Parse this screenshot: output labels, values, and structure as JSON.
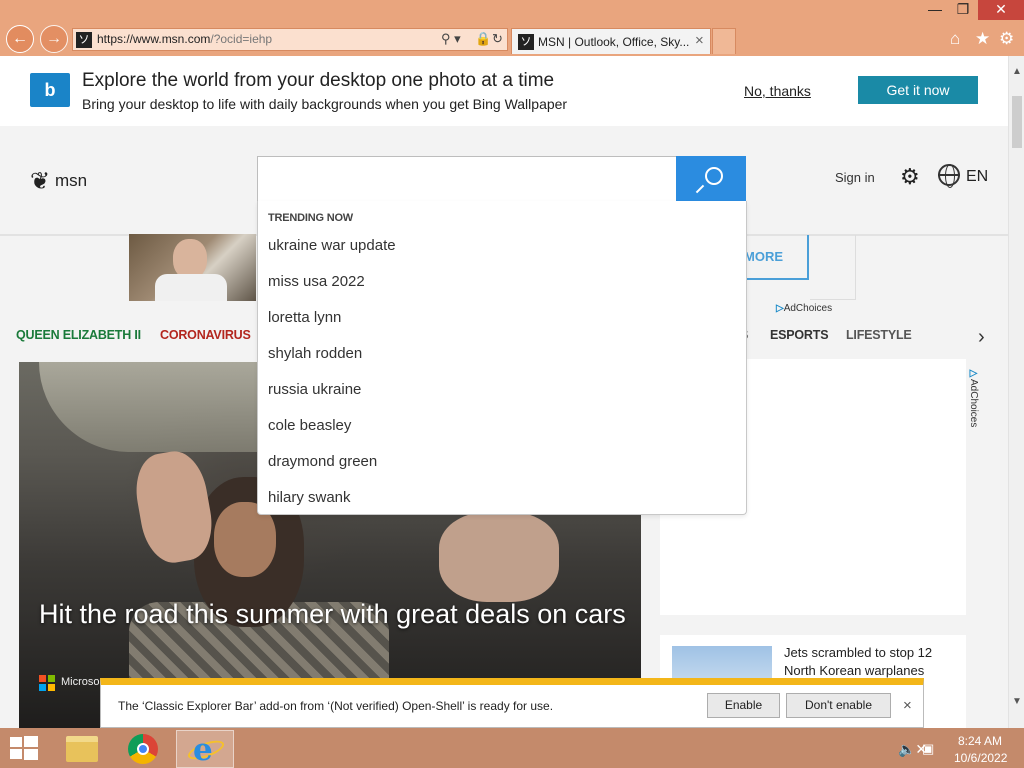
{
  "browser": {
    "address_url_main": "https://www.msn.com",
    "address_url_rest": "/?ocid=iehp",
    "tab_title": "MSN | Outlook, Office, Sky...",
    "tab_close": "×",
    "minimize": "—",
    "restore": "❐",
    "close": "✕"
  },
  "banner": {
    "title": "Explore the world from your desktop one photo at a time",
    "subtitle": "Bring your desktop to life with daily backgrounds when you get Bing Wallpaper",
    "no_thanks": "No, thanks",
    "get_it_now": "Get it now"
  },
  "header": {
    "brand": "msn",
    "sign_in": "Sign in",
    "language": "EN"
  },
  "search": {
    "placeholder": "",
    "trending_heading": "TRENDING NOW",
    "suggestions": [
      "ukraine war update",
      "miss usa 2022",
      "loretta lynn",
      "shylah rodden",
      "russia ukraine",
      "cole beasley",
      "draymond green",
      "hilary swank"
    ]
  },
  "ad": {
    "more_label": "MORE",
    "adchoices": "AdChoices"
  },
  "nav": {
    "tabs": [
      "QUEEN ELIZABETH II",
      "CORONAVIRUS",
      "S",
      "ESPORTS",
      "LIFESTYLE"
    ],
    "colors": [
      "#1a7a3a",
      "#b3261e",
      "#555555",
      "#333333",
      "#555555"
    ]
  },
  "hero": {
    "title": "Hit the road this summer with great deals on cars",
    "source": "Microso"
  },
  "news": {
    "headline": "Jets scrambled to stop 12 North Korean warplanes"
  },
  "notification": {
    "message": "The ‘Classic Explorer Bar’ add-on from ‘(Not verified) Open-Shell’ is ready for use.",
    "enable": "Enable",
    "dont_enable": "Don't enable",
    "close": "×"
  },
  "taskbar": {
    "time": "8:24 AM",
    "date": "10/6/2022"
  },
  "colors": {
    "chrome": "#e9a57e",
    "accent_blue": "#2b8ce0",
    "get_it_now": "#1a8aa6",
    "taskbar": "#c48a6b",
    "notification_bar": "#f3b619"
  }
}
